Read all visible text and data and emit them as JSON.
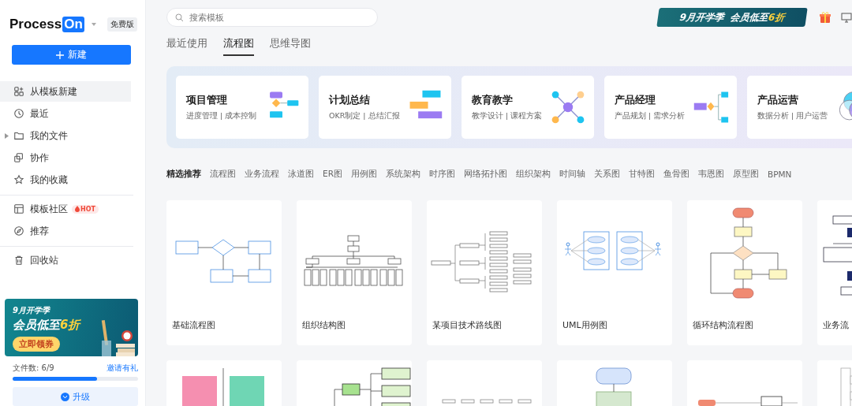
{
  "logo": {
    "text": "Process",
    "badge": "On"
  },
  "plan": "免费版",
  "new_button": {
    "label": "新建"
  },
  "sidebar": {
    "groups": [
      [
        {
          "label": "从模板新建",
          "selected": true,
          "caret": false
        },
        {
          "label": "最近",
          "selected": false,
          "caret": false
        },
        {
          "label": "我的文件",
          "selected": false,
          "caret": true
        },
        {
          "label": "协作",
          "selected": false,
          "caret": false
        },
        {
          "label": "我的收藏",
          "selected": false,
          "caret": false
        }
      ],
      [
        {
          "label": "模板社区",
          "selected": false,
          "caret": false,
          "badge": "HOT"
        },
        {
          "label": "推荐",
          "selected": false,
          "caret": false
        }
      ],
      [
        {
          "label": "回收站",
          "selected": false,
          "caret": false
        }
      ]
    ]
  },
  "promo": {
    "title": "9月开学季",
    "headline": "会员低至",
    "highlight": "6折",
    "button": "立即领券"
  },
  "files": {
    "label": "文件数: 6/9",
    "level": 0.67,
    "link": "邀请有礼"
  },
  "upgrade": {
    "label": "升级"
  },
  "search": {
    "placeholder": "搜索模板"
  },
  "top_banner": {
    "title": "9月开学季",
    "headline": "会员低至",
    "highlight": "6折"
  },
  "tabs": [
    {
      "label": "最近使用",
      "selected": false
    },
    {
      "label": "流程图",
      "selected": true
    },
    {
      "label": "思维导图",
      "selected": false
    }
  ],
  "categories": [
    {
      "title": "项目管理",
      "subtitle": "进度管理 | 成本控制",
      "kind": "flow"
    },
    {
      "title": "计划总结",
      "subtitle": "OKR制定 | 总结汇报",
      "kind": "gantt"
    },
    {
      "title": "教育教学",
      "subtitle": "教学设计 | 课程方案",
      "kind": "network"
    },
    {
      "title": "产品经理",
      "subtitle": "产品规划 | 需求分析",
      "kind": "tree"
    },
    {
      "title": "产品运营",
      "subtitle": "数据分析 | 用户运营",
      "kind": "venn"
    }
  ],
  "filters": [
    {
      "label": "精选推荐",
      "selected": true
    },
    {
      "label": "流程图",
      "selected": false
    },
    {
      "label": "业务流程",
      "selected": false
    },
    {
      "label": "泳道图",
      "selected": false
    },
    {
      "label": "ER图",
      "selected": false
    },
    {
      "label": "用例图",
      "selected": false
    },
    {
      "label": "系统架构",
      "selected": false
    },
    {
      "label": "时序图",
      "selected": false
    },
    {
      "label": "网络拓扑图",
      "selected": false
    },
    {
      "label": "组织架构",
      "selected": false
    },
    {
      "label": "时间轴",
      "selected": false
    },
    {
      "label": "关系图",
      "selected": false
    },
    {
      "label": "甘特图",
      "selected": false
    },
    {
      "label": "鱼骨图",
      "selected": false
    },
    {
      "label": "韦恩图",
      "selected": false
    },
    {
      "label": "原型图",
      "selected": false
    },
    {
      "label": "BPMN",
      "selected": false
    }
  ],
  "templates": [
    {
      "title": "基础流程图",
      "kind": "flowchart"
    },
    {
      "title": "组织结构图",
      "kind": "org"
    },
    {
      "title": "某项目技术路线图",
      "kind": "roadmap"
    },
    {
      "title": "UML用例图",
      "kind": "uml"
    },
    {
      "title": "循环结构流程图",
      "kind": "loop"
    },
    {
      "title": "业务流",
      "kind": "business"
    },
    {
      "kind": "matrix"
    },
    {
      "kind": "mindtree"
    },
    {
      "kind": "timeline"
    },
    {
      "kind": "process"
    },
    {
      "kind": "line"
    },
    {
      "kind": "outline"
    }
  ]
}
